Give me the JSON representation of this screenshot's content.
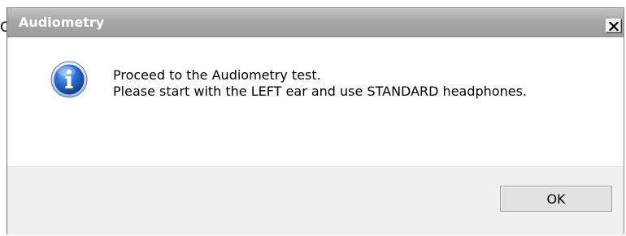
{
  "background_fragment": "C",
  "dialog": {
    "title": "Audiometry",
    "close_icon": "close-icon",
    "icon": "information-icon",
    "message_line1": "Proceed to the Audiometry test.",
    "message_line2": "Please start with the LEFT ear and use STANDARD headphones.",
    "ok_label": "OK"
  },
  "colors": {
    "titlebar": "#a8a8a8",
    "title_text": "#ffffff",
    "footer": "#f0f0f0",
    "info_icon_blue": "#1f5fc4"
  }
}
